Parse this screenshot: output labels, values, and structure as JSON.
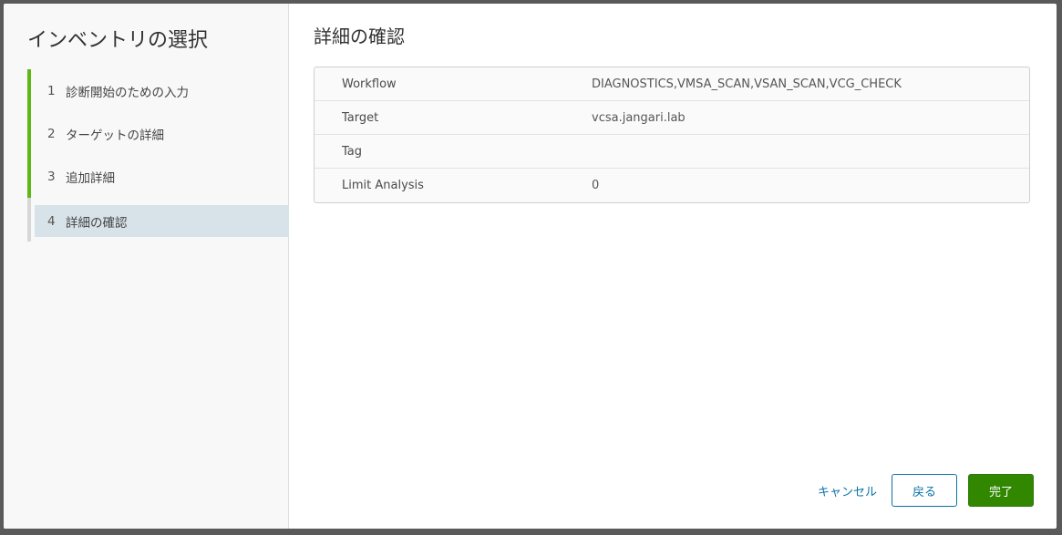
{
  "sidebar": {
    "title": "インベントリの選択",
    "steps": [
      {
        "num": "1",
        "label": "診断開始のための入力"
      },
      {
        "num": "2",
        "label": "ターゲットの詳細"
      },
      {
        "num": "3",
        "label": "追加詳細"
      },
      {
        "num": "4",
        "label": "詳細の確認"
      }
    ]
  },
  "main": {
    "title": "詳細の確認",
    "rows": [
      {
        "key": "Workflow",
        "value": "DIAGNOSTICS,VMSA_SCAN,VSAN_SCAN,VCG_CHECK"
      },
      {
        "key": "Target",
        "value": "vcsa.jangari.lab"
      },
      {
        "key": "Tag",
        "value": ""
      },
      {
        "key": "Limit Analysis",
        "value": "0"
      }
    ]
  },
  "footer": {
    "cancel_label": "キャンセル",
    "back_label": "戻る",
    "finish_label": "完了"
  },
  "colors": {
    "step_complete": "#5eb715",
    "step_active_bg": "#d8e3e9",
    "link": "#0b72a8",
    "primary": "#318700"
  }
}
